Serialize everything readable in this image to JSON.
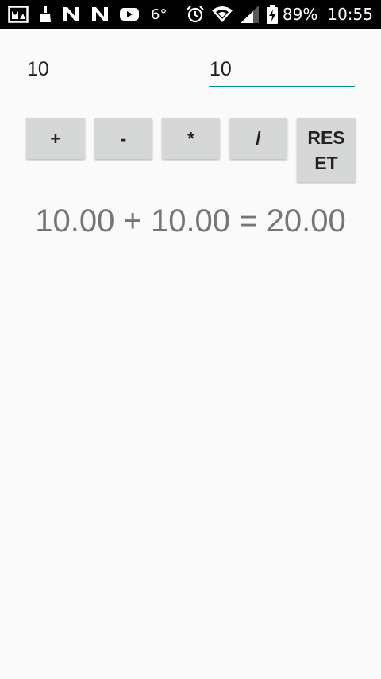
{
  "status_bar": {
    "icons_left": [
      "gallery-icon",
      "cleaner-icon",
      "n-logo-icon",
      "n-logo-icon",
      "youtube-icon"
    ],
    "temperature": "6°",
    "icons_right": [
      "alarm-icon",
      "wifi-icon",
      "signal-icon",
      "battery-charging-icon"
    ],
    "battery": "89%",
    "time": "10:55"
  },
  "inputs": {
    "first_value": "10",
    "second_value": "10"
  },
  "buttons": {
    "add": "+",
    "subtract": "-",
    "multiply": "*",
    "divide": "/",
    "reset": "RESET"
  },
  "result": "10.00 + 10.00 = 20.00",
  "colors": {
    "accent": "#009688",
    "status_bar": "#000000",
    "background": "#fafafa",
    "button": "#d6d7d7"
  }
}
